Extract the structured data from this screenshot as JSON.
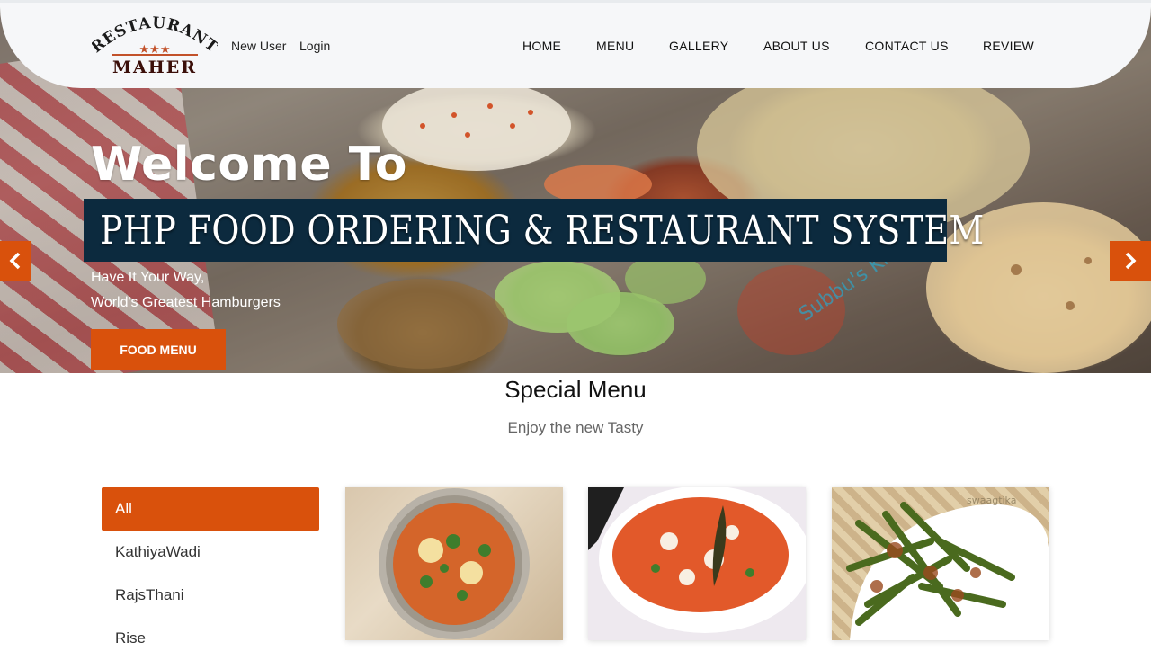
{
  "header": {
    "logo": {
      "line1": "RESTAURANT",
      "line2": "MAHER",
      "stars": "★★★"
    },
    "account_links": [
      "New User",
      "Login"
    ],
    "nav": [
      "HOME",
      "MENU",
      "GALLERY",
      "ABOUT US",
      "CONTACT US",
      "REVIEW"
    ]
  },
  "hero": {
    "title": "Welcome To",
    "banner": "PHP FOOD ORDERING & RESTAURANT  SYSTEM",
    "subtitle_line1": "Have It Your Way,",
    "subtitle_line2": "World's Greatest Hamburgers",
    "cta": "FOOD MENU",
    "watermark": "Subbu's Kitchen"
  },
  "special": {
    "title": "Special Menu",
    "subtitle": "Enjoy the new Tasty",
    "categories": [
      "All",
      "KathiyaWadi",
      "RajsThani",
      "Rise"
    ],
    "active_category": "All",
    "card_watermark": "swaagtika"
  },
  "colors": {
    "accent": "#d9510c",
    "banner": "#0c2a3e"
  }
}
